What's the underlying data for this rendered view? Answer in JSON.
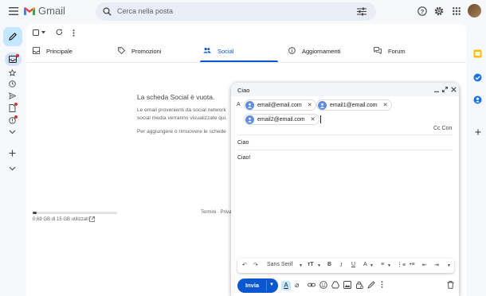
{
  "header": {
    "app_name": "Gmail",
    "search_placeholder": "Cerca nella posta"
  },
  "toolbar": {},
  "tabs": [
    {
      "label": "Principale",
      "icon": "inbox-icon",
      "active": false
    },
    {
      "label": "Promozioni",
      "icon": "tag-icon",
      "active": false
    },
    {
      "label": "Social",
      "icon": "people-icon",
      "active": true
    },
    {
      "label": "Aggiornamenti",
      "icon": "info-icon",
      "active": false
    },
    {
      "label": "Forum",
      "icon": "forum-icon",
      "active": false
    }
  ],
  "empty_state": {
    "title": "La scheda Social è vuota.",
    "line1": "Le email provenienti da social network",
    "line2": "social media verranno visualizzate qui.",
    "line3": "Per aggiungere o rimuovere le schede"
  },
  "storage": {
    "label": "0,69 GB di 15 GB utilizzati",
    "used_fraction": 0.046
  },
  "footer": {
    "links": "Termini · Privac"
  },
  "compose": {
    "title": "Ciao",
    "to_label": "A",
    "recipients": [
      "email@email.com",
      "email1@email.com",
      "email2@email.com"
    ],
    "cc_label": "Cc Con",
    "subject": "Ciao",
    "body": "Ciao!",
    "font_name": "Sans Serif",
    "send_label": "Invia"
  },
  "colors": {
    "accent": "#0b57d0",
    "background": "#f6f8fc",
    "search_bg": "#e9eef6"
  }
}
